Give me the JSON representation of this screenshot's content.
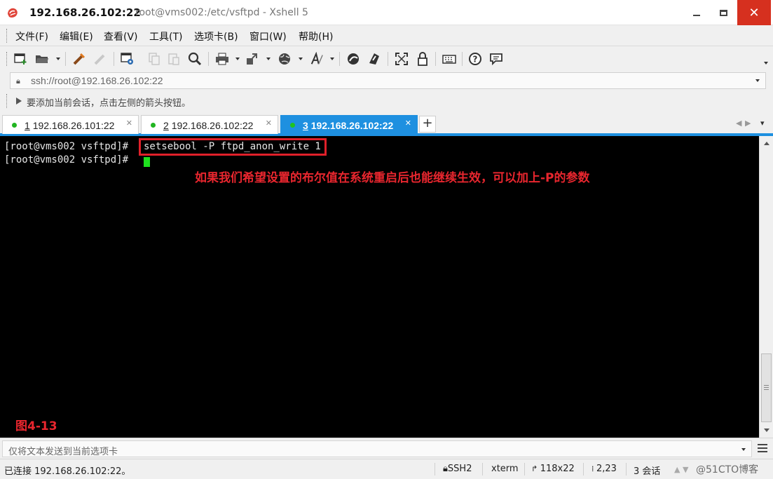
{
  "window": {
    "host_title": "192.168.26.102:22",
    "path_title": "root@vms002:/etc/vsftpd - Xshell 5",
    "close_glyph": "✕"
  },
  "menu": [
    "文件(F)",
    "编辑(E)",
    "查看(V)",
    "工具(T)",
    "选项卡(B)",
    "窗口(W)",
    "帮助(H)"
  ],
  "toolbar": {
    "icons": [
      "new-session-icon",
      "open-folder-icon",
      "reconnect-icon",
      "disconnect-icon",
      "properties-icon",
      "copy-icon",
      "paste-icon",
      "find-icon",
      "print-icon",
      "transfer-icon",
      "globe-icon",
      "font-icon",
      "xftp-icon",
      "xmanager-icon",
      "fullscreen-icon",
      "lock-icon",
      "keyboard-icon",
      "help-icon",
      "chat-icon"
    ]
  },
  "address": {
    "value": "ssh://root@192.168.26.102:22"
  },
  "hint": {
    "text": "要添加当前会话，点击左侧的箭头按钮。"
  },
  "tabs": [
    {
      "num": "1",
      "label": "192.168.26.101:22",
      "active": false
    },
    {
      "num": "2",
      "label": "192.168.26.102:22",
      "active": false
    },
    {
      "num": "3",
      "label": "192.168.26.102:22",
      "active": true
    }
  ],
  "tab_add": "+",
  "terminal": {
    "prompt1": "[root@vms002 vsftpd]#",
    "command1": "setsebool -P ftpd_anon_write 1",
    "prompt2": "[root@vms002 vsftpd]#",
    "annotation": "如果我们希望设置的布尔值在系统重启后也能继续生效，可以加上-P的参数",
    "figure_label": "图4-13"
  },
  "sendbar": {
    "placeholder": "仅将文本发送到当前选项卡"
  },
  "status": {
    "connection": "已连接 192.168.26.102:22。",
    "protocol": "SSH2",
    "terminal_type": "xterm",
    "size": "118x22",
    "cursor_pos": "2,23",
    "sessions": "3 会话"
  },
  "watermark": "@51CTO博客",
  "colors": {
    "accent": "#1e90e0",
    "annotation_red": "#e8262e",
    "cursor_green": "#1ee01e",
    "terminal_bg": "#000000"
  }
}
